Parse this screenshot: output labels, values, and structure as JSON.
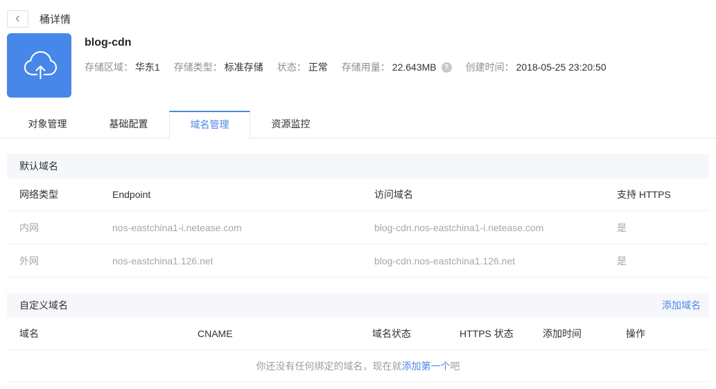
{
  "topbar": {
    "title": "桶详情"
  },
  "bucket": {
    "name": "blog-cdn",
    "help_icon_glyph": "?",
    "info": [
      {
        "label": "存储区域：",
        "value": "华东1",
        "help": false
      },
      {
        "label": "存储类型：",
        "value": "标准存储",
        "help": false
      },
      {
        "label": "状态：",
        "value": "正常",
        "help": false
      },
      {
        "label": "存储用量：",
        "value": "22.643MB",
        "help": true
      },
      {
        "label": "创建时间：",
        "value": "2018-05-25 23:20:50",
        "help": false
      }
    ]
  },
  "tabs": [
    {
      "label": "对象管理",
      "active": false
    },
    {
      "label": "基础配置",
      "active": false
    },
    {
      "label": "域名管理",
      "active": true
    },
    {
      "label": "资源监控",
      "active": false
    }
  ],
  "default_domain": {
    "section_title": "默认域名",
    "columns": [
      "网络类型",
      "Endpoint",
      "访问域名",
      "支持 HTTPS"
    ],
    "rows": [
      [
        "内网",
        "nos-eastchina1-i.netease.com",
        "blog-cdn.nos-eastchina1-i.netease.com",
        "是"
      ],
      [
        "外网",
        "nos-eastchina1.126.net",
        "blog-cdn.nos-eastchina1.126.net",
        "是"
      ]
    ]
  },
  "custom_domain": {
    "section_title": "自定义域名",
    "add_link_label": "添加域名",
    "columns": [
      "域名",
      "CNAME",
      "域名状态",
      "HTTPS 状态",
      "添加时间",
      "操作"
    ],
    "empty_state": {
      "prefix": "你还没有任何绑定的域名，现在就",
      "link": "添加第一个",
      "suffix": "吧"
    }
  },
  "colors": {
    "accent": "#4a86e8",
    "icon_background": "#4787ea",
    "section_bar_background": "#f5f7fa",
    "muted_text": "#a3a7ad",
    "border": "#ebeef5"
  }
}
